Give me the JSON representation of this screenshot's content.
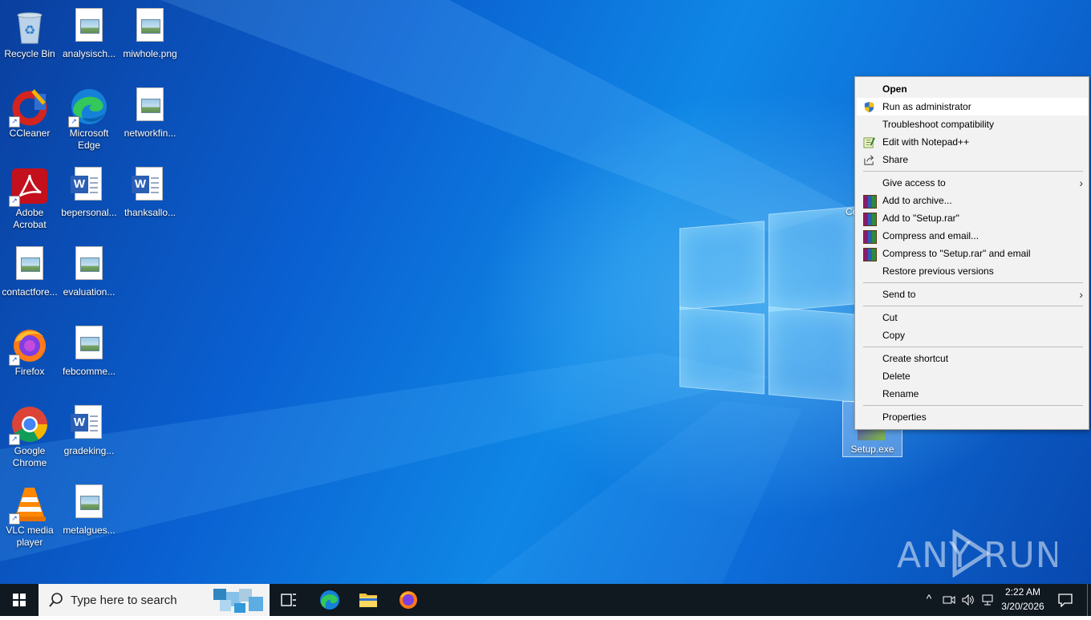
{
  "desktop": {
    "icons": [
      {
        "label": "Recycle Bin",
        "icon": "recycle-bin-icon"
      },
      {
        "label": "analysisch...",
        "icon": "image-file-icon"
      },
      {
        "label": "miwhole.png",
        "icon": "image-file-icon"
      },
      {
        "label": "CCleaner",
        "icon": "ccleaner-icon"
      },
      {
        "label": "Microsoft Edge",
        "icon": "edge-icon"
      },
      {
        "label": "networkfin...",
        "icon": "image-file-icon"
      },
      {
        "label": "Adobe Acrobat",
        "icon": "acrobat-icon"
      },
      {
        "label": "bepersonal...",
        "icon": "word-doc-icon"
      },
      {
        "label": "thanksallo...",
        "icon": "word-doc-icon"
      },
      {
        "label": "contactfore...",
        "icon": "image-file-icon"
      },
      {
        "label": "evaluation...",
        "icon": "image-file-icon"
      },
      {
        "label": "Firefox",
        "icon": "firefox-icon"
      },
      {
        "label": "febcomme...",
        "icon": "image-file-icon"
      },
      {
        "label": "Google Chrome",
        "icon": "chrome-icon"
      },
      {
        "label": "gradeking...",
        "icon": "word-doc-icon"
      },
      {
        "label": "VLC media player",
        "icon": "vlc-icon"
      },
      {
        "label": "metalgues...",
        "icon": "image-file-icon"
      }
    ],
    "selected_file": {
      "label": "Setup.exe"
    },
    "partial_label": "Co",
    "watermark": "ANY RUN"
  },
  "context_menu": {
    "items": [
      {
        "label": "Open",
        "bold": true
      },
      {
        "label": "Run as administrator",
        "icon": "uac-shield-icon"
      },
      {
        "label": "Troubleshoot compatibility"
      },
      {
        "label": "Edit with Notepad++",
        "icon": "notepad-plus-plus-icon"
      },
      {
        "label": "Share",
        "icon": "share-icon"
      },
      {
        "label": "Give access to",
        "submenu": true
      },
      {
        "label": "Add to archive...",
        "icon": "winrar-icon"
      },
      {
        "label": "Add to \"Setup.rar\"",
        "icon": "winrar-icon"
      },
      {
        "label": "Compress and email...",
        "icon": "winrar-icon"
      },
      {
        "label": "Compress to \"Setup.rar\" and email",
        "icon": "winrar-icon"
      },
      {
        "label": "Restore previous versions"
      },
      {
        "label": "Send to",
        "submenu": true
      },
      {
        "label": "Cut"
      },
      {
        "label": "Copy"
      },
      {
        "label": "Create shortcut"
      },
      {
        "label": "Delete"
      },
      {
        "label": "Rename"
      },
      {
        "label": "Properties"
      }
    ]
  },
  "taskbar": {
    "search_placeholder": "Type here to search",
    "time": "2:22 AM",
    "date": "3/20/2026"
  },
  "colors": {
    "accent": "#0078d7",
    "taskbar": "#101820",
    "menu_bg": "#f2f2f2"
  }
}
